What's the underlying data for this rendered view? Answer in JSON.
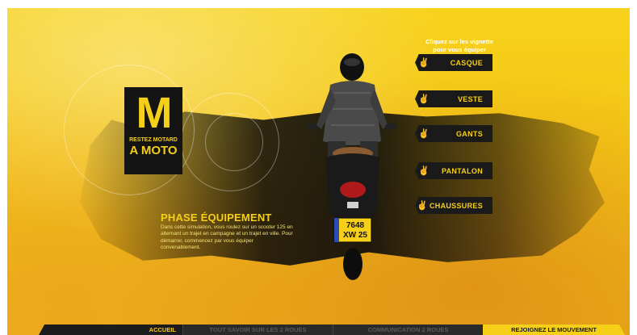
{
  "logo": {
    "letter": "M",
    "tagline_small": "RESTEZ MOTARD",
    "tagline_big": "A MOTO"
  },
  "phase": {
    "title": "PHASE ÉQUIPEMENT",
    "description": "Dans cette simulation, vous roulez sur un scooter 125 en alternant un trajet en campagne et un trajet en ville. Pour démarrer, commencez par vous équiper convenablement."
  },
  "instructions": "Cliquez sur les vignette pour vous équiper",
  "equipment": [
    {
      "label": "CASQUE"
    },
    {
      "label": "VESTE"
    },
    {
      "label": "GANTS"
    },
    {
      "label": "PANTALON"
    },
    {
      "label": "CHAUSSURES"
    }
  ],
  "plate": {
    "line1": "7648",
    "line2": "XW 25"
  },
  "nav": {
    "item1": "ACCUEIL",
    "item2": "TOUT SAVOIR SUR LES 2 ROUES",
    "item3": "COMMUNICATION 2 ROUES",
    "item4": "REJOIGNEZ LE MOUVEMENT"
  },
  "colors": {
    "accent": "#f6cf18",
    "dark": "#141414"
  },
  "icons": {
    "equipment_button": "hand-v-sign-icon"
  }
}
